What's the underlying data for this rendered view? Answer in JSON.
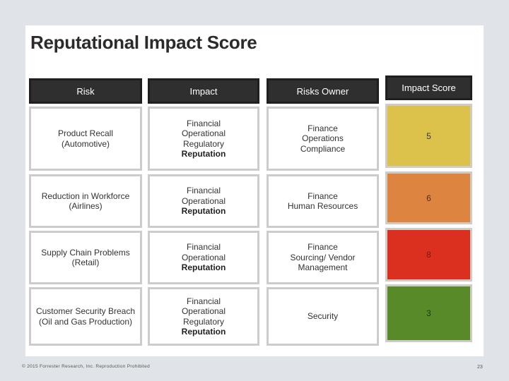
{
  "slide": {
    "title": "Reputational Impact Score",
    "footer": "© 2015 Forrester Research, Inc. Reproduction Prohibited",
    "page_number": "23"
  },
  "table": {
    "headers": {
      "risk": "Risk",
      "impact": "Impact",
      "owner": "Risks Owner",
      "score": "Impact Score"
    },
    "rows": [
      {
        "risk": [
          "Product Recall",
          "(Automotive)"
        ],
        "impact": [
          "Financial",
          "Operational",
          "Regulatory"
        ],
        "impact_bold": "Reputation",
        "owner": [
          "Finance",
          "Operations",
          "Compliance"
        ],
        "score": "5",
        "score_color": "#dcc14a",
        "score_text_color": "#3a3520"
      },
      {
        "risk": [
          "Reduction in Workforce",
          "(Airlines)"
        ],
        "impact": [
          "Financial",
          "Operational"
        ],
        "impact_bold": "Reputation",
        "owner": [
          "Finance",
          "Human Resources"
        ],
        "score": "6",
        "score_color": "#dd8540",
        "score_text_color": "#5a2a14"
      },
      {
        "risk": [
          "Supply Chain Problems",
          "(Retail)"
        ],
        "impact": [
          "Financial",
          "Operational"
        ],
        "impact_bold": "Reputation",
        "owner": [
          "Finance",
          "Sourcing/ Vendor",
          "Management"
        ],
        "score": "8",
        "score_color": "#db3020",
        "score_text_color": "#7a1a12"
      },
      {
        "risk": [
          "Customer Security Breach",
          "(Oil and Gas Production)"
        ],
        "impact": [
          "Financial",
          "Operational",
          "Regulatory"
        ],
        "impact_bold": "Reputation",
        "owner": [
          "Security"
        ],
        "score": "3",
        "score_color": "#588a2a",
        "score_text_color": "#233a12"
      }
    ]
  }
}
